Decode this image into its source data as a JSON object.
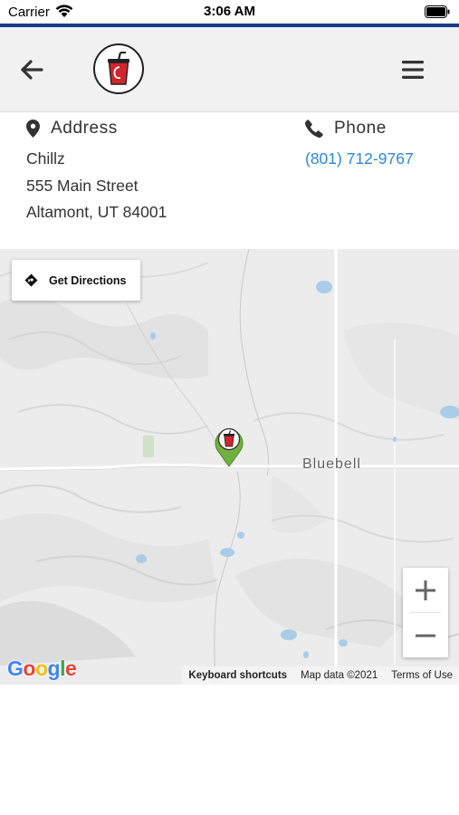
{
  "status_bar": {
    "carrier": "Carrier",
    "time": "3:06 AM",
    "wifi_icon": "wifi-icon",
    "battery_icon": "battery-icon"
  },
  "header": {
    "back_icon": "arrow-left-icon",
    "logo_icon": "drink-cup-logo",
    "menu_icon": "hamburger-menu-icon",
    "stripe_color": "#1c3a8a"
  },
  "address": {
    "heading": "Address",
    "icon": "map-pin-icon",
    "name": "Chillz",
    "street": "555 Main Street",
    "city_state_zip": "Altamont, UT 84001"
  },
  "phone": {
    "heading": "Phone",
    "icon": "phone-icon",
    "number": "(801) 712-9767",
    "link_color": "#2a8ad8"
  },
  "map": {
    "directions_label": "Get Directions",
    "directions_icon": "directions-diamond-icon",
    "place_label": "Bluebell",
    "marker_icon": "map-marker-cup-icon",
    "zoom_in": "+",
    "zoom_out": "−",
    "google_logo": "Google",
    "keyboard_shortcuts": "Keyboard shortcuts",
    "map_data": "Map data ©2021",
    "terms": "Terms of Use",
    "marker_color": "#6fb23f"
  }
}
